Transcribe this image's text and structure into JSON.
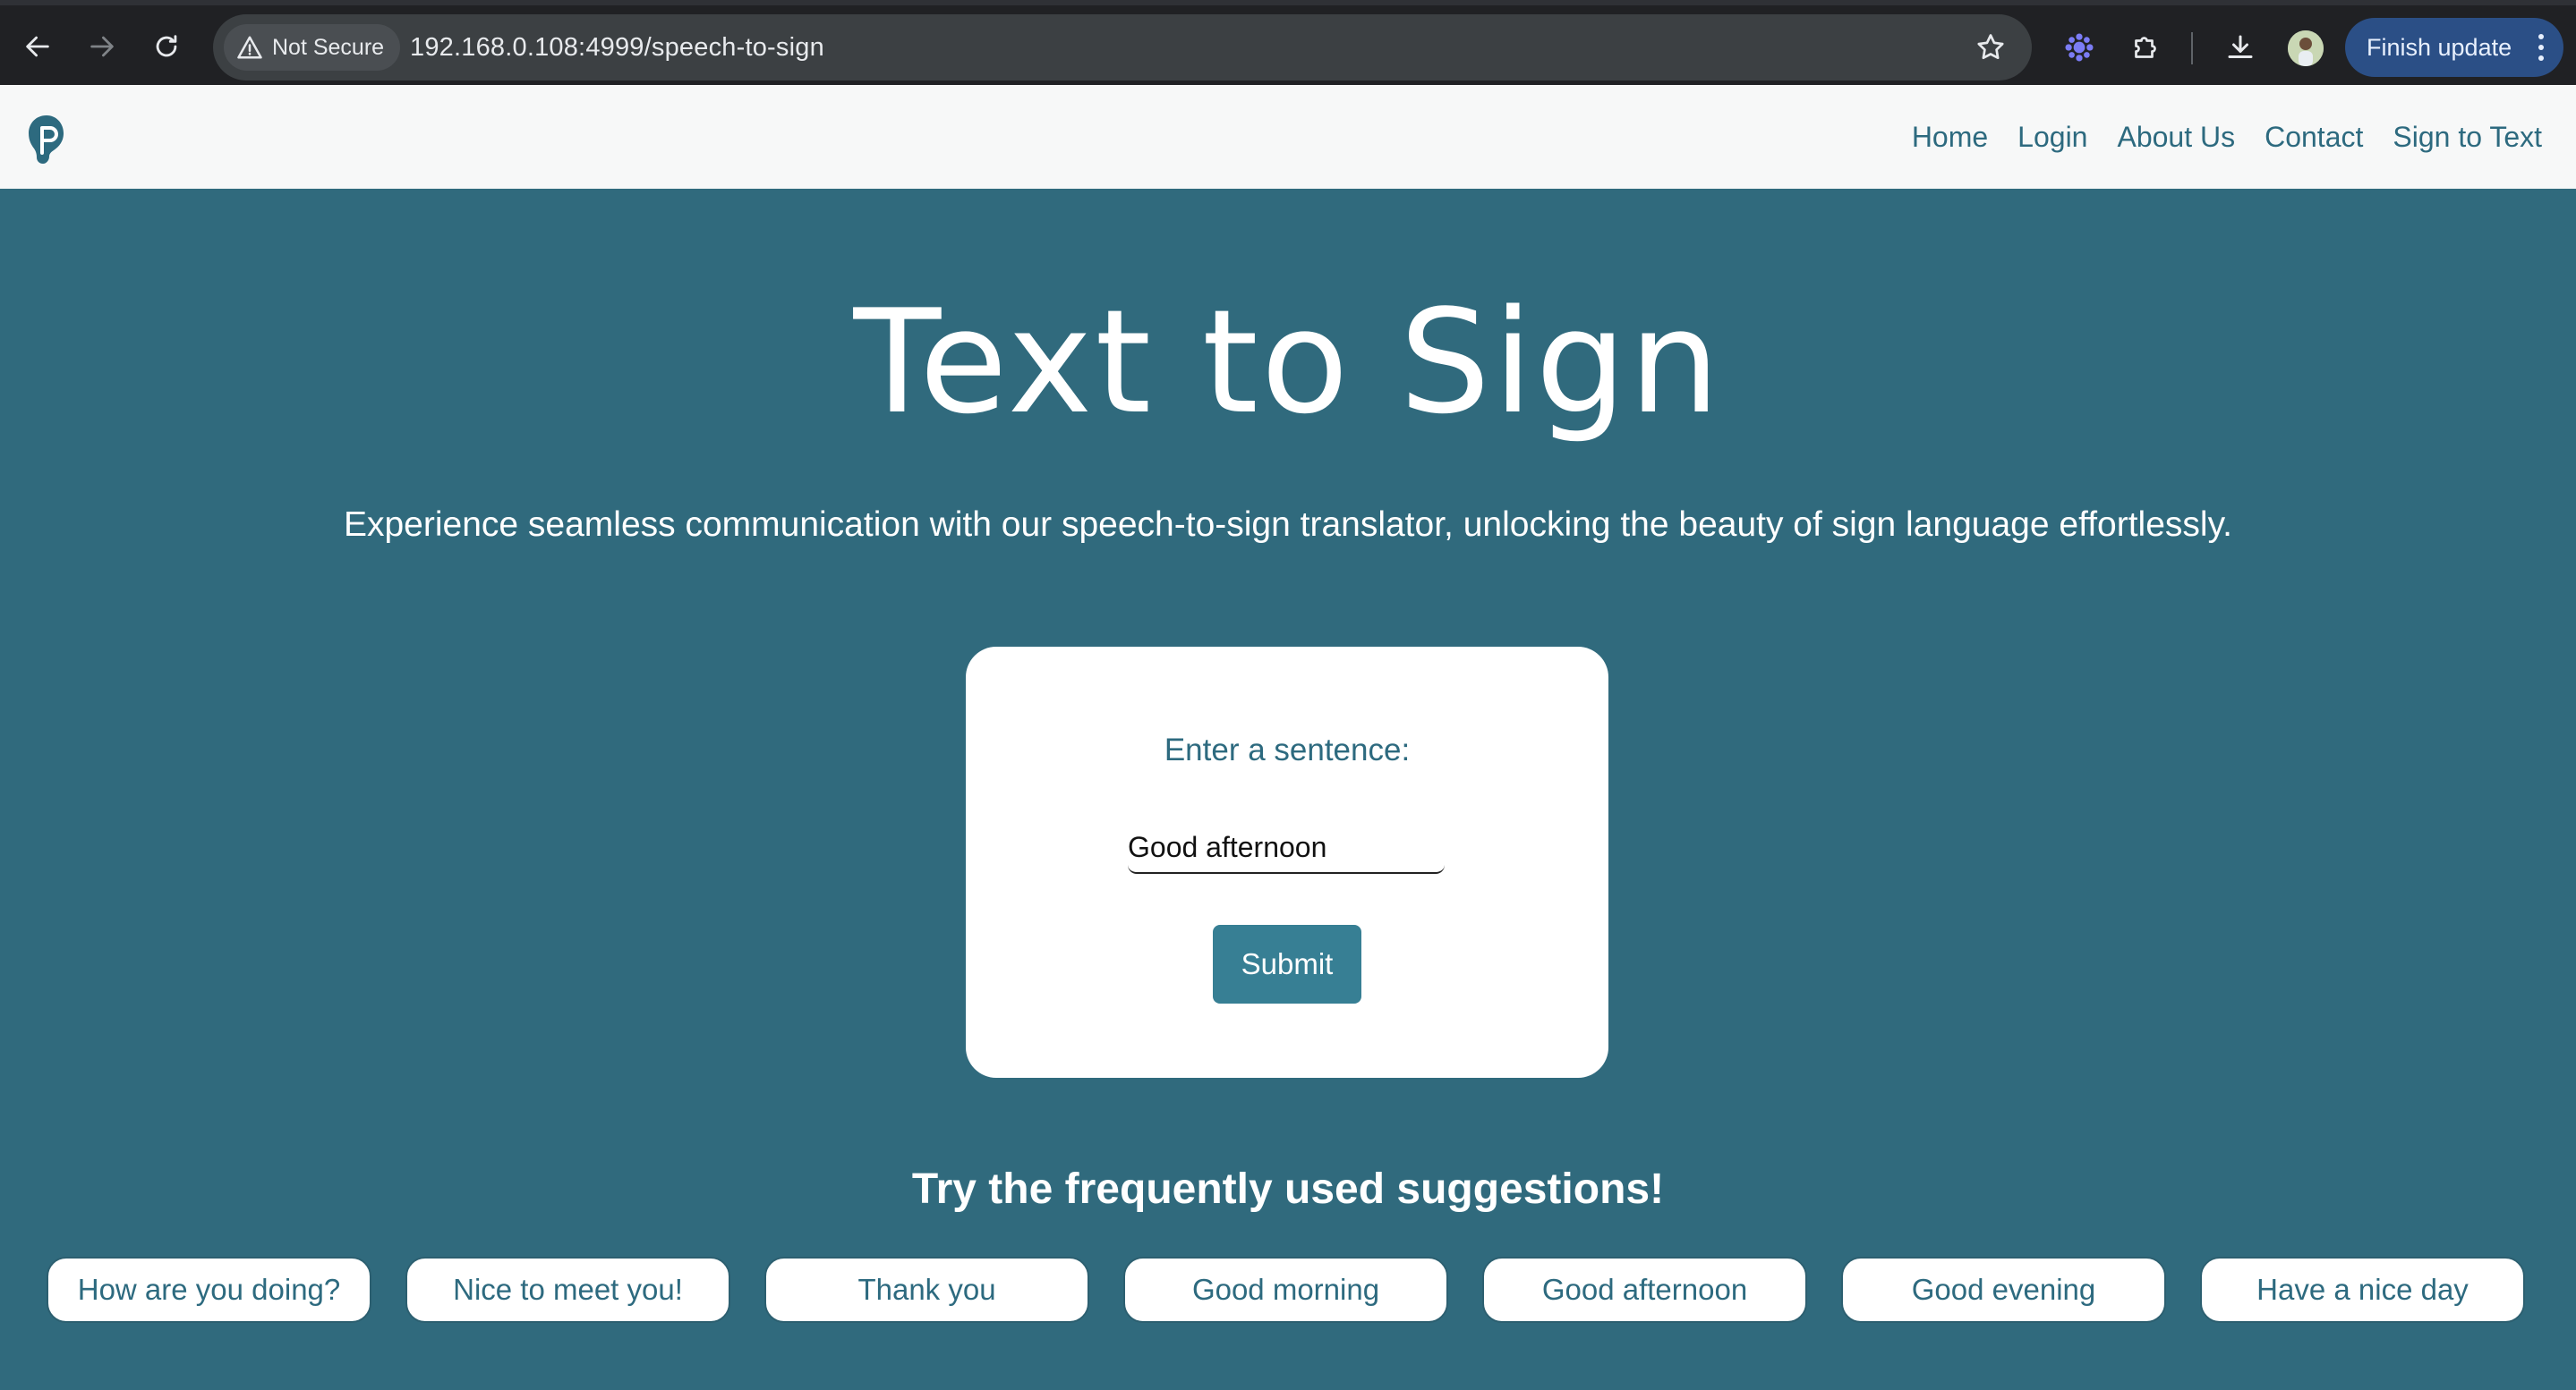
{
  "browser": {
    "security_label": "Not Secure",
    "url": "192.168.0.108:4999/speech-to-sign",
    "finish_update_label": "Finish update"
  },
  "header": {
    "nav": [
      "Home",
      "Login",
      "About Us",
      "Contact",
      "Sign to Text"
    ]
  },
  "hero": {
    "title": "Text to Sign",
    "subtitle": "Experience seamless communication with our speech-to-sign translator, unlocking the beauty of sign language effortlessly."
  },
  "form": {
    "label": "Enter a sentence:",
    "input_value": "Good afternoon",
    "submit_label": "Submit"
  },
  "suggestions": {
    "title": "Try the frequently used suggestions!",
    "items": [
      "How are you doing?",
      "Nice to meet you!",
      "Thank you",
      "Good morning",
      "Good afternoon",
      "Good evening",
      "Have a nice day"
    ]
  },
  "colors": {
    "background": "#306a7d",
    "accent": "#377f94",
    "link": "#2d6a7f"
  }
}
